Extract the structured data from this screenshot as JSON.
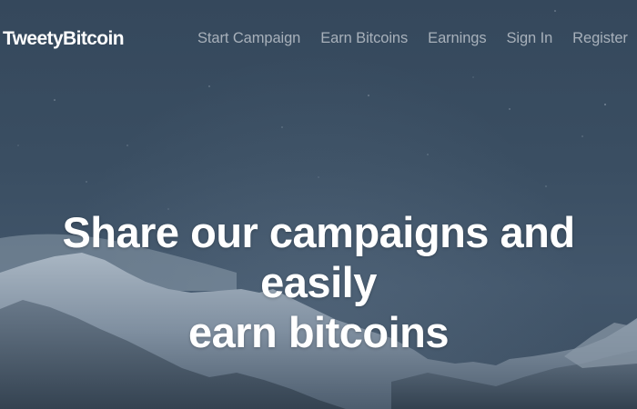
{
  "navbar": {
    "brand": "TweetyBitcoin",
    "links": [
      {
        "label": "Start Campaign"
      },
      {
        "label": "Earn Bitcoins"
      },
      {
        "label": "Earnings"
      },
      {
        "label": "Sign In"
      },
      {
        "label": "Register"
      }
    ]
  },
  "hero": {
    "title_lines": [
      "Share our campaigns and",
      "easily",
      "earn bitcoins"
    ]
  },
  "colors": {
    "sky": "#34475a",
    "nav_link": "#a7b0ba",
    "brand": "#ffffff",
    "hero_text": "#ffffff"
  }
}
